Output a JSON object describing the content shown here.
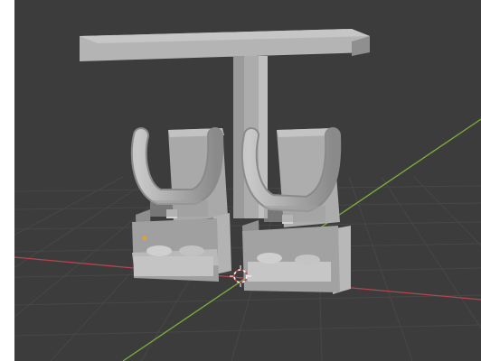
{
  "viewport": {
    "background": "#3c3c3c",
    "grid_color": "#4a4a4a",
    "x_axis_color": "#b5454f",
    "y_axis_color": "#7fae3a",
    "model_color": "#b8b8b8",
    "model_shade": "#8e8e8e",
    "model_dark": "#6e6e6e",
    "origin_marker": "3d-cursor-icon",
    "light_marker": "light-origin-icon"
  }
}
